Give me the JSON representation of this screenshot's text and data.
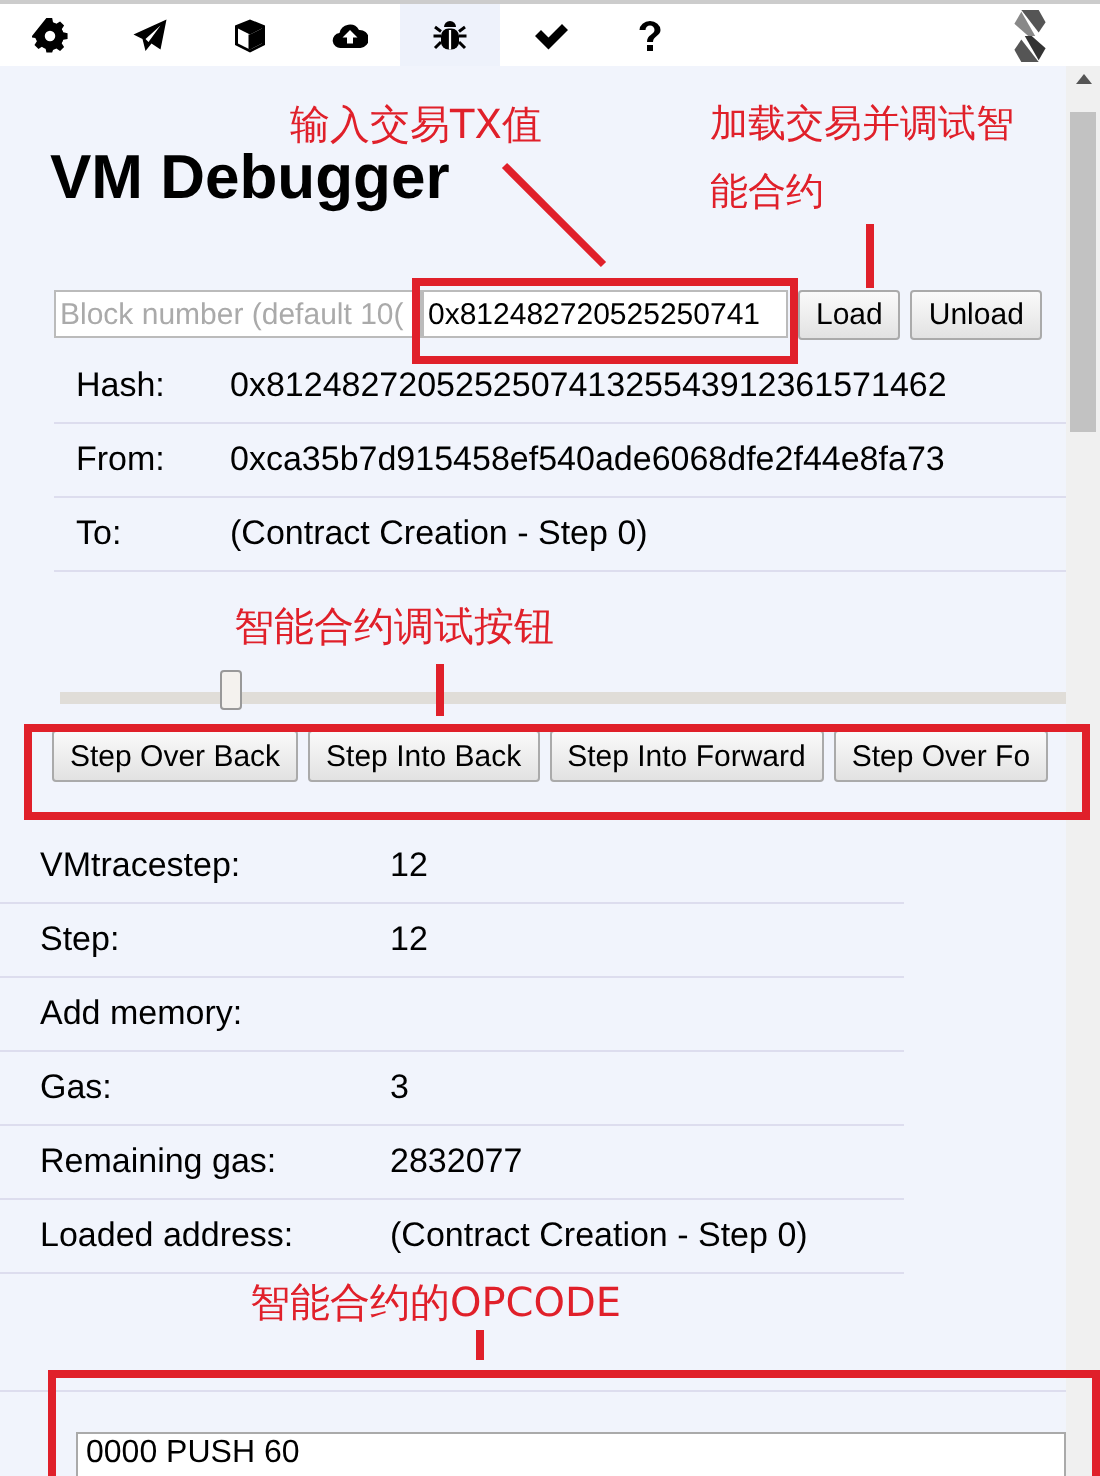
{
  "toolbar": {
    "tabs": [
      {
        "kind": "settings",
        "selected": false
      },
      {
        "kind": "send",
        "selected": false
      },
      {
        "kind": "cube",
        "selected": false
      },
      {
        "kind": "cloud",
        "selected": false
      },
      {
        "kind": "bug",
        "selected": true
      },
      {
        "kind": "check",
        "selected": false
      },
      {
        "kind": "help",
        "selected": false
      }
    ]
  },
  "debugger": {
    "title": "VM Debugger",
    "block_field": {
      "placeholder": "Block number (default 10("
    },
    "tx_field": {
      "value": "0x812482720525250741"
    },
    "buttons": [
      "Load",
      "Unload"
    ],
    "transaction": [
      {
        "label": "Hash:",
        "value": "0x812482720525250741325543912361571462"
      },
      {
        "label": "From:",
        "value": "0xca35b7d915458ef540ade6068dfe2f44e8fa73"
      },
      {
        "label": "To:",
        "value": "(Contract Creation - Step 0)"
      }
    ],
    "slider": {
      "level": 0.16
    },
    "step_buttons": [
      "Step Over Back",
      "Step Into Back",
      "Step Into Forward",
      "Step Over Fo"
    ],
    "state": [
      {
        "label": "VMtracestep:",
        "value": "12"
      },
      {
        "label": "Step:",
        "value": "12"
      },
      {
        "label": "Add memory:"
      },
      {
        "label": "Gas:",
        "value": "3"
      },
      {
        "label": "Remaining gas:",
        "value": "2832077"
      },
      {
        "label": "Loaded address:",
        "value": "(Contract Creation - Step 0)"
      }
    ],
    "opcodes": [
      "0000 PUSH 60"
    ]
  },
  "annotations": [
    {
      "kind": "tx",
      "text": "输入交易TX值"
    },
    {
      "kind": "load",
      "lines": [
        "加载交易并调试智",
        "能合约"
      ]
    },
    {
      "kind": "steps",
      "text": "智能合约调试按钮"
    },
    {
      "kind": "opcode",
      "text": "智能合约的OPCODE"
    }
  ]
}
